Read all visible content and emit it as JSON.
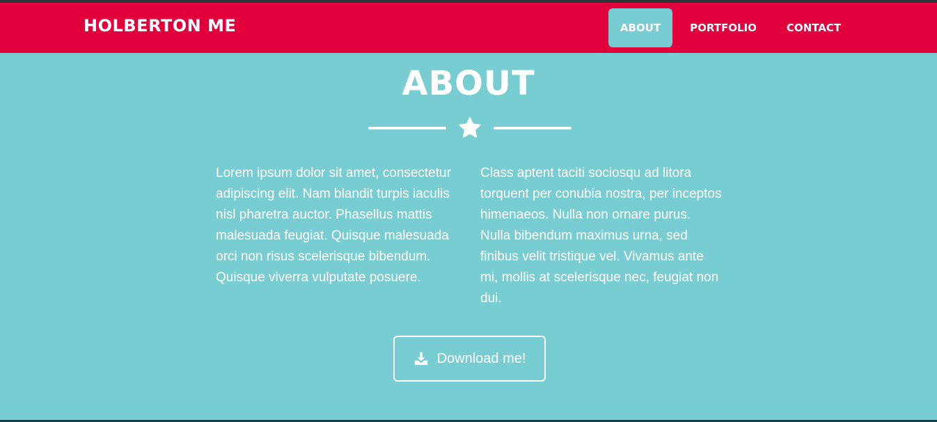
{
  "navbar": {
    "brand": "HOLBERTON ME",
    "items": [
      {
        "label": "ABOUT",
        "active": true
      },
      {
        "label": "PORTFOLIO",
        "active": false
      },
      {
        "label": "CONTACT",
        "active": false
      }
    ]
  },
  "about": {
    "title": "ABOUT",
    "divider_icon": "star-icon",
    "paragraphs": [
      "Lorem ipsum dolor sit amet, consectetur adipiscing elit. Nam blandit turpis iaculis nisl pharetra auctor. Phasellus mattis malesuada feugiat. Quisque malesuada orci non risus scelerisque bibendum. Quisque viverra vulputate posuere.",
      "Class aptent taciti sociosqu ad litora torquent per conubia nostra, per inceptos himenaeos. Nulla non ornare purus. Nulla bibendum maximus urna, sed finibus velit tristique vel. Vivamus ante mi, mollis at scelerisque nec, feugiat non dui."
    ],
    "download": {
      "label": "Download me!",
      "icon": "download-icon"
    }
  },
  "colors": {
    "navbar": "#e2003c",
    "background": "#78cdd2",
    "text": "#ffffff"
  }
}
